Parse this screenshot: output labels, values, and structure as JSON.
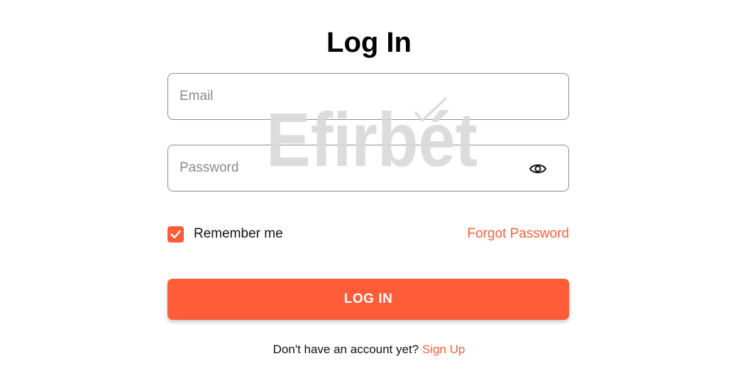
{
  "title": "Log In",
  "email": {
    "placeholder": "Email",
    "value": ""
  },
  "password": {
    "placeholder": "Password",
    "value": ""
  },
  "remember": {
    "label": "Remember me",
    "checked": true
  },
  "forgot_label": "Forgot Password",
  "login_label": "LOG IN",
  "signup": {
    "prompt": "Don't have an account yet? ",
    "link_label": "Sign Up"
  },
  "watermark": "Efirbét",
  "colors": {
    "accent": "#ff5c39",
    "border": "#8c8c8c",
    "watermark": "#d9d9d9"
  },
  "icons": {
    "password_toggle": "eye-icon",
    "checkbox": "checkmark-icon"
  }
}
